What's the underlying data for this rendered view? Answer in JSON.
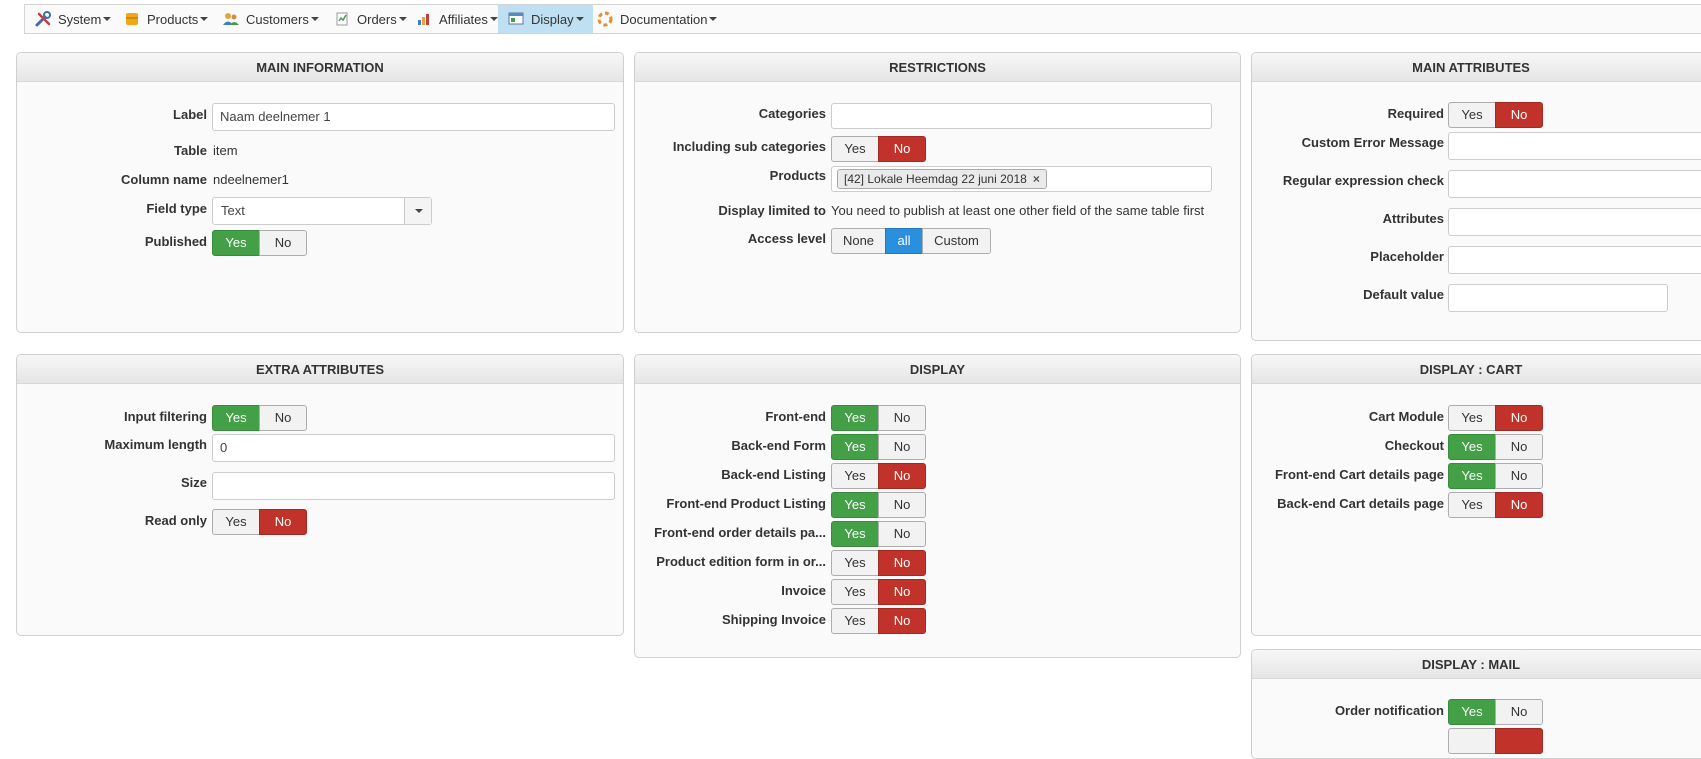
{
  "menu": [
    {
      "label": "System",
      "icon": "tools-icon"
    },
    {
      "label": "Products",
      "icon": "products-icon"
    },
    {
      "label": "Customers",
      "icon": "customers-icon"
    },
    {
      "label": "Orders",
      "icon": "orders-icon"
    },
    {
      "label": "Affiliates",
      "icon": "affiliates-icon"
    },
    {
      "label": "Display",
      "icon": "display-icon",
      "active": true
    },
    {
      "label": "Documentation",
      "icon": "documentation-icon"
    }
  ],
  "colors": {
    "yes_active": "#43a047",
    "no_active": "#c0322a",
    "selected": "#2a8fdc",
    "menu_active": "#bfe0f2"
  },
  "main_info": {
    "title": "MAIN INFORMATION",
    "label_label": "Label",
    "label_value": "Naam deelnemer 1",
    "table_label": "Table",
    "table_value": "item",
    "column_label": "Column name",
    "column_value": "ndeelnemer1",
    "fieldtype_label": "Field type",
    "fieldtype_value": "Text",
    "published_label": "Published"
  },
  "restrictions": {
    "title": "RESTRICTIONS",
    "categories_label": "Categories",
    "categories_value": "",
    "subcat_label": "Including sub categories",
    "products_label": "Products",
    "products_tag": "[42] Lokale Heemdag 22 juni 2018",
    "display_limited_label": "Display limited to",
    "display_limited_value": "You need to publish at least one other field of the same table first",
    "access_label": "Access level",
    "access_options": [
      "None",
      "all",
      "Custom"
    ],
    "access_selected": "all"
  },
  "main_attributes": {
    "title": "MAIN ATTRIBUTES",
    "required_label": "Required",
    "error_label": "Custom Error Message",
    "regex_label": "Regular expression check",
    "attributes_label": "Attributes",
    "placeholder_label": "Placeholder",
    "default_label": "Default value"
  },
  "extra_attributes": {
    "title": "EXTRA ATTRIBUTES",
    "filter_label": "Input filtering",
    "maxlen_label": "Maximum length",
    "maxlen_value": "0",
    "size_label": "Size",
    "size_value": "",
    "readonly_label": "Read only"
  },
  "display": {
    "title": "DISPLAY",
    "rows": [
      {
        "label": "Front-end",
        "value": "Yes"
      },
      {
        "label": "Back-end Form",
        "value": "Yes"
      },
      {
        "label": "Back-end Listing",
        "value": "No"
      },
      {
        "label": "Front-end Product Listing",
        "value": "Yes"
      },
      {
        "label": "Front-end order details pa...",
        "value": "Yes"
      },
      {
        "label": "Product edition form in or...",
        "value": "No"
      },
      {
        "label": "Invoice",
        "value": "No"
      },
      {
        "label": "Shipping Invoice",
        "value": "No"
      }
    ]
  },
  "display_cart": {
    "title": "DISPLAY : CART",
    "rows": [
      {
        "label": "Cart Module",
        "value": "No"
      },
      {
        "label": "Checkout",
        "value": "Yes"
      },
      {
        "label": "Front-end Cart details page",
        "value": "Yes"
      },
      {
        "label": "Back-end Cart details page",
        "value": "No"
      }
    ]
  },
  "display_mail": {
    "title": "DISPLAY : MAIL",
    "order_notification_label": "Order notification"
  },
  "toggle": {
    "yes": "Yes",
    "no": "No"
  }
}
